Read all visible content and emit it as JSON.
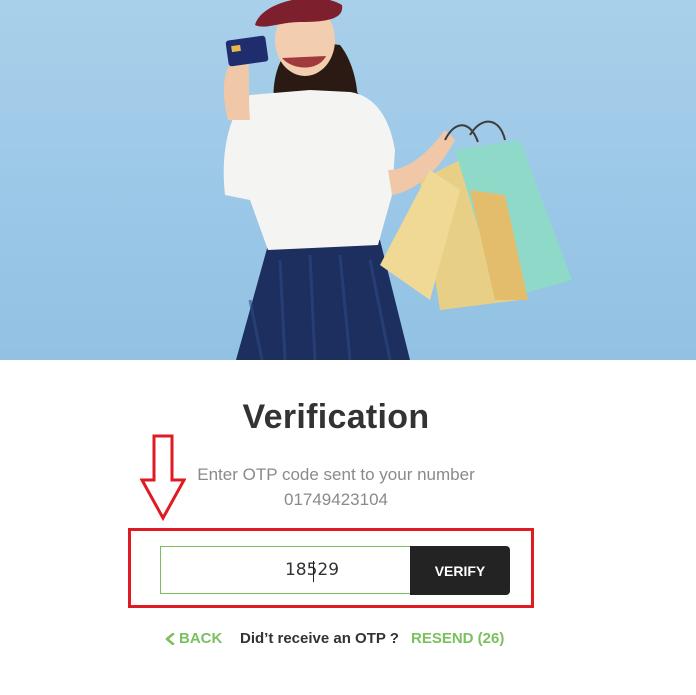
{
  "hero": {
    "icon": "shopping-woman-illustration"
  },
  "heading": {
    "title": "Verification"
  },
  "instructions": {
    "line1": "Enter OTP code sent to your number",
    "phone": "01749423104"
  },
  "otp_form": {
    "value": "18529",
    "verify_label": "VERIFY"
  },
  "footer": {
    "back_label": "BACK",
    "prompt": "Did’t receive an OTP ?",
    "resend_label": "RESEND (26)"
  },
  "colors": {
    "accent_green": "#7cbf5e",
    "highlight_red": "#e01a22",
    "button_dark": "#232323",
    "hero_blue": "#9ac7e7"
  }
}
